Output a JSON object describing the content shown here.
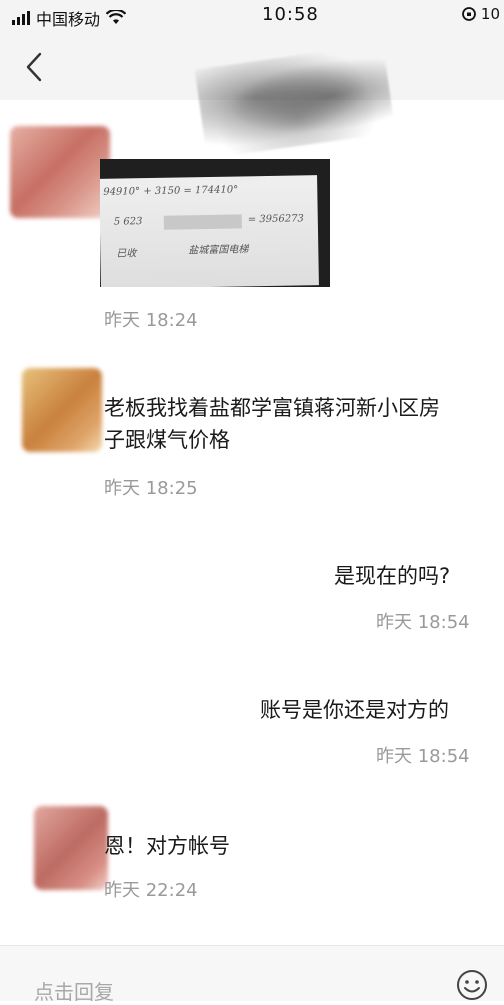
{
  "status_bar": {
    "carrier": "中国移动",
    "time": "10:58",
    "battery_text": "10"
  },
  "nav": {
    "back_icon": "chevron-left-icon"
  },
  "messages": [
    {
      "from": "other",
      "type": "image",
      "photo_text": {
        "line1": "94910° + 3150 = 174410°",
        "line2": "5 623",
        "line3": "= 3956273",
        "line4": "已收",
        "line5": "盐城富国电梯"
      },
      "time": "昨天 18:24"
    },
    {
      "from": "other",
      "type": "text",
      "text_line1": "老板我找着盐都学富镇蒋河新小区房",
      "text_line2": "子跟煤气价格",
      "time": "昨天 18:25"
    },
    {
      "from": "me",
      "type": "text",
      "text": "是现在的吗?",
      "time": "昨天 18:54"
    },
    {
      "from": "me",
      "type": "text",
      "text": "账号是你还是对方的",
      "time": "昨天 18:54"
    },
    {
      "from": "other",
      "type": "text",
      "text": "恩！对方帐号",
      "time": "昨天 22:24"
    }
  ],
  "reply_bar": {
    "placeholder": "点击回复",
    "emoji_icon": "emoji-smile-icon"
  }
}
